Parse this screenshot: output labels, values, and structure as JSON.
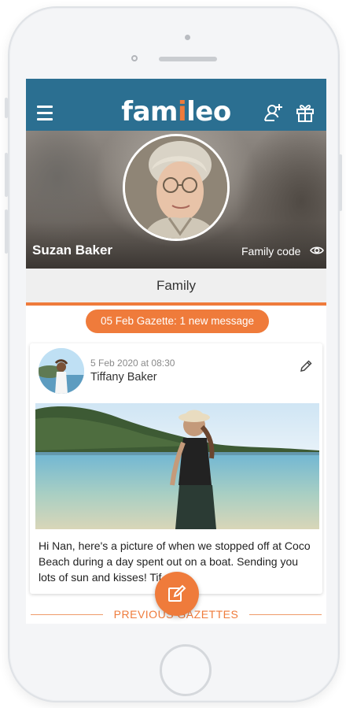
{
  "app": {
    "logo_text_before": "fam",
    "logo_text_accent": "i",
    "logo_text_after": "leo",
    "colors": {
      "brand_blue": "#2b6f91",
      "accent_orange": "#ef7b3b"
    }
  },
  "header": {
    "menu_icon": "hamburger-icon",
    "add_user_icon": "add-user-icon",
    "gift_icon": "gift-icon"
  },
  "profile": {
    "name": "Suzan Baker",
    "family_code_label": "Family code",
    "family_code_icon": "eye-icon"
  },
  "tabs": {
    "active": "Family"
  },
  "gazette_badge": "05 Feb Gazette: 1 new message",
  "post": {
    "date": "5 Feb 2020 at 08:30",
    "author": "Tiffany Baker",
    "text": "Hi Nan,  here's a picture of when we stopped off at Coco Beach during a day spent out on a boat. Sending you lots of sun        and kisses! Tif"
  },
  "previous_gazettes_label": "PREVIOUS GAZETTES",
  "fab_icon": "compose-icon"
}
